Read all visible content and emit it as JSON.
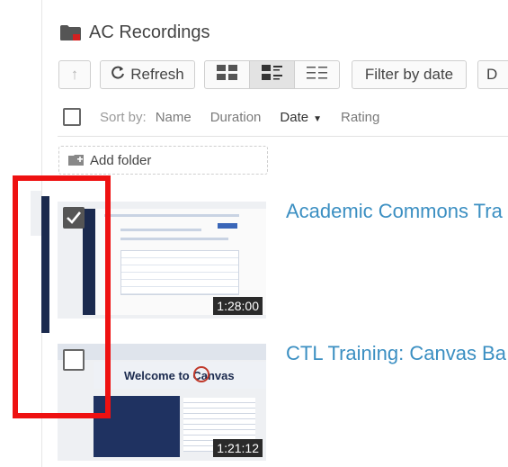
{
  "header": {
    "title": "AC Recordings",
    "folder_color": "#555555",
    "folder_badge_color": "#d42020"
  },
  "toolbar": {
    "up_icon": "↑",
    "refresh_label": "Refresh",
    "view_modes": [
      "thumbnails",
      "details",
      "list"
    ],
    "active_view": "details",
    "filter_label": "Filter by date",
    "cut_label": "D"
  },
  "sort": {
    "label": "Sort by:",
    "options": [
      "Name",
      "Duration",
      "Date",
      "Rating"
    ],
    "active": "Date"
  },
  "add_folder_label": "Add folder",
  "videos": [
    {
      "title": "Academic Commons Tra",
      "duration": "1:28:00",
      "checked": true
    },
    {
      "title": "CTL Training: Canvas Ba",
      "duration": "1:21:12",
      "checked": false,
      "thumb_heading": "Welcome to Canvas"
    }
  ],
  "colors": {
    "accent": "#3b8fc2",
    "nav_dark": "#1b2a4e",
    "highlight": "#ee1111"
  }
}
